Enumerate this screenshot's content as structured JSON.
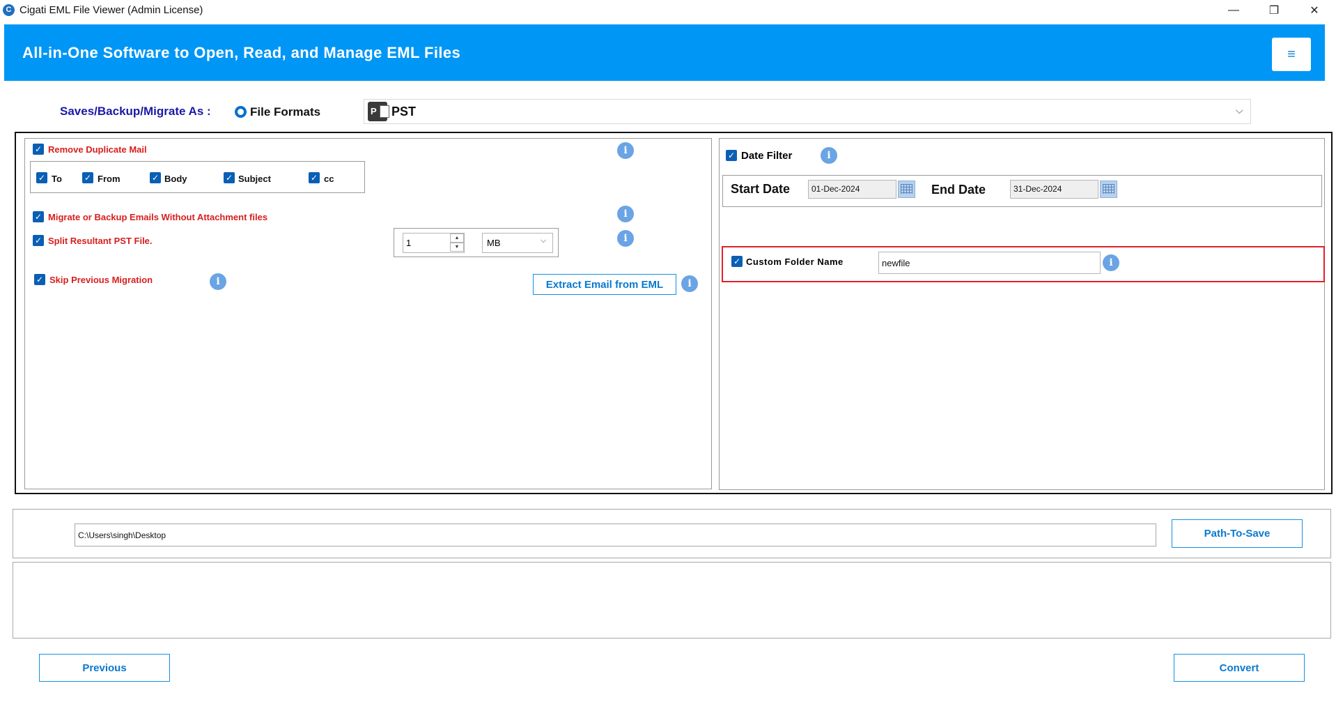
{
  "window": {
    "app_icon_glyph": "C",
    "title": "Cigati EML File Viewer (Admin License)",
    "minimize_glyph": "—",
    "maximize_glyph": "❐",
    "close_glyph": "✕"
  },
  "header": {
    "title": "All-in-One Software to Open, Read, and Manage EML Files",
    "menu_glyph": "≡"
  },
  "save_as": {
    "label": "Saves/Backup/Migrate As :",
    "radio_label": "File Formats",
    "selected_format": "PST",
    "format_icon_letter": "P"
  },
  "left_options": {
    "remove_duplicate": "Remove Duplicate Mail",
    "duplicate_fields": [
      "To",
      "From",
      "Body",
      "Subject",
      "cc"
    ],
    "without_attachments": "Migrate or Backup Emails Without Attachment files",
    "split_pst": "Split Resultant PST File.",
    "split_value": "1",
    "split_unit": "MB",
    "skip_previous": "Skip Previous Migration",
    "extract_button": "Extract Email from EML"
  },
  "right_options": {
    "date_filter": "Date Filter",
    "start_label": "Start Date",
    "start_value": "01-Dec-2024",
    "end_label": "End Date",
    "end_value": "31-Dec-2024",
    "custom_folder_label": "Custom Folder Name",
    "custom_folder_value": "newfile"
  },
  "path": {
    "value": "C:\\Users\\singh\\Desktop",
    "button": "Path-To-Save"
  },
  "footer": {
    "previous": "Previous",
    "convert": "Convert"
  },
  "glyphs": {
    "check": "✓",
    "info": "i",
    "chevron": "⌵",
    "spin_up": "▲",
    "spin_down": "▼"
  },
  "colors": {
    "banner": "#0096f5",
    "accent_blue": "#0a79cf",
    "label_red": "#d81e1e",
    "highlight_red": "#e0202a"
  }
}
